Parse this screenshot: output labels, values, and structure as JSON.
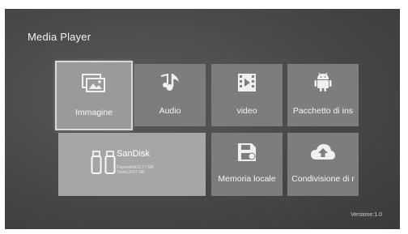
{
  "app": {
    "title": "Media Player",
    "version": "Versione:1.0"
  },
  "tiles": {
    "image": {
      "label": "Immagine",
      "icon": "image-gallery-icon"
    },
    "audio": {
      "label": "Audio",
      "icon": "music-note-icon"
    },
    "video": {
      "label": "video",
      "icon": "film-icon"
    },
    "package": {
      "label": "Pacchetto di ins",
      "icon": "android-icon"
    },
    "local": {
      "label": "Memoria locale",
      "icon": "save-disk-icon"
    },
    "share": {
      "label": "Condivisione di r",
      "icon": "cloud-upload-icon"
    }
  },
  "storage": {
    "name": "SanDisk",
    "available": "Disponibile12.77 GB",
    "total": "Totale15.57 GB",
    "icon": "usb-drive-icon"
  },
  "colors": {
    "background": "#474747",
    "tile": "#7d7d7d",
    "selected_tile": "#9a9a9a",
    "storage_tile": "#a6a6a6"
  }
}
